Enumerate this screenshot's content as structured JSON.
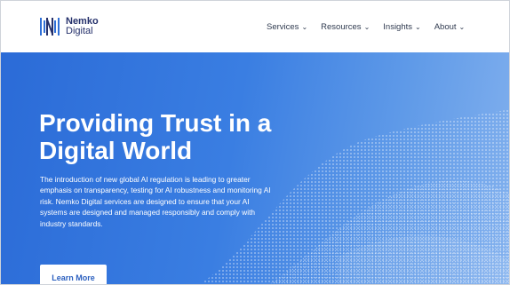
{
  "brand": {
    "name": "Nemko",
    "sub": "Digital"
  },
  "nav": {
    "items": [
      {
        "label": "Services",
        "icon": "chevron-down-icon"
      },
      {
        "label": "Resources",
        "icon": "chevron-down-icon"
      },
      {
        "label": "Insights",
        "icon": "chevron-down-icon"
      },
      {
        "label": "About",
        "icon": "chevron-down-icon"
      }
    ]
  },
  "hero": {
    "headline_line1": "Providing Trust in a",
    "headline_line2": "Digital World",
    "intro": "The introduction of new global AI regulation is leading to greater emphasis on transparency, testing for AI robustness and monitoring AI risk. Nemko Digital services are designed to ensure that your AI systems are designed and managed responsibly and comply with industry standards.",
    "cta_label": "Learn More"
  },
  "colors": {
    "brand_navy": "#24306b",
    "hero_blue": "#2b6bd7",
    "hero_light": "#83b1ee",
    "cta_text": "#2b5fbf"
  }
}
